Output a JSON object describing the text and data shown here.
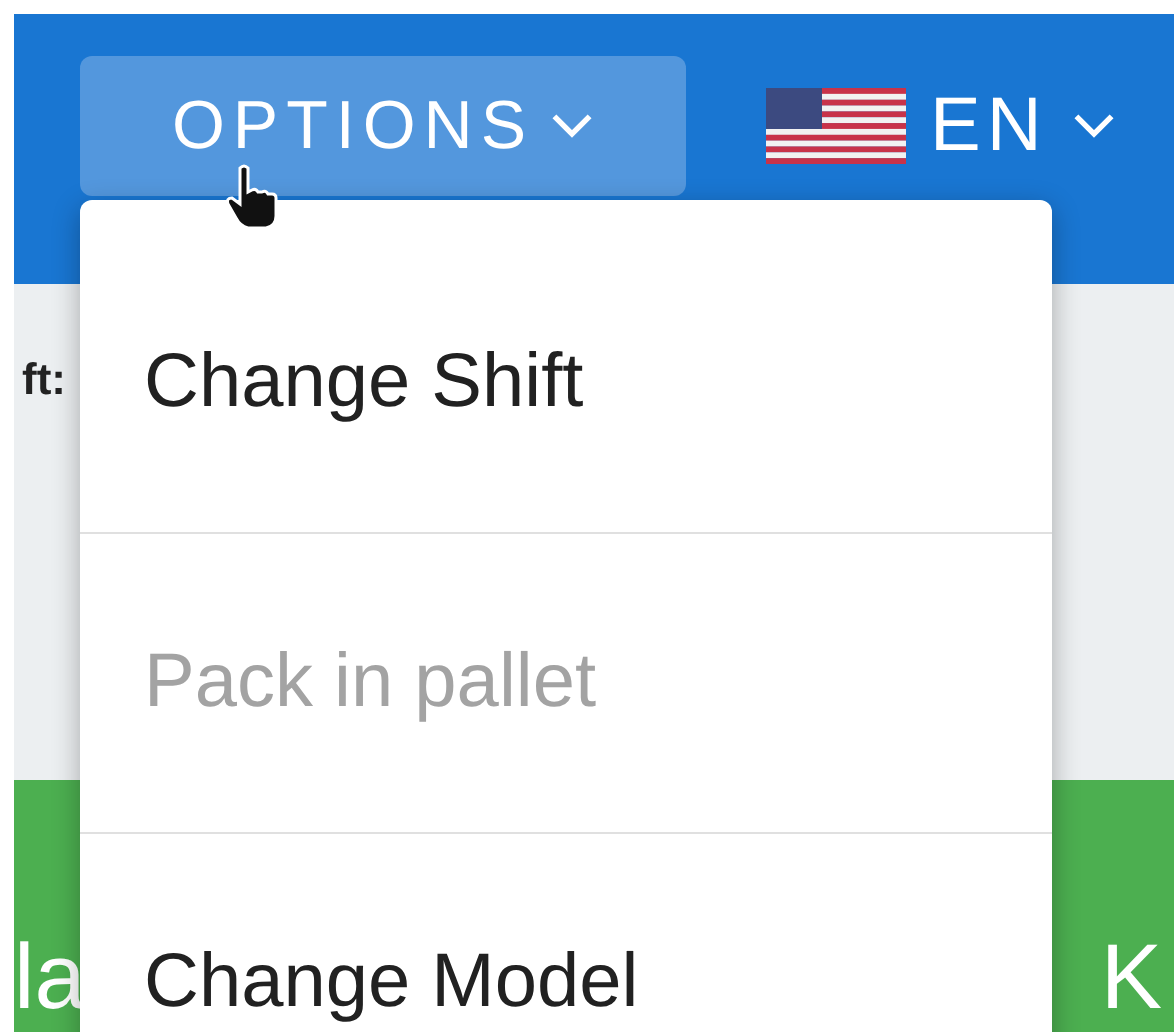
{
  "header": {
    "options_button": {
      "label": "OPTIONS",
      "expanded": true
    },
    "language_button": {
      "label": "EN"
    }
  },
  "page": {
    "field_label": "ft:",
    "banner_left": "la",
    "banner_right": "K"
  },
  "menu": {
    "items": [
      {
        "label": "Change Shift",
        "disabled": false
      },
      {
        "label": "Pack in pallet",
        "disabled": true
      },
      {
        "label": "Change Model",
        "disabled": false
      }
    ]
  }
}
